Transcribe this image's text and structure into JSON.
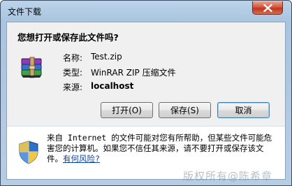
{
  "window": {
    "title": "文件下载",
    "question": "您想打开或保存此文件吗?"
  },
  "file": {
    "name_label": "名称:",
    "name": "Test.zip",
    "type_label": "类型:",
    "type": "WinRAR ZIP 压缩文件",
    "from_label": "来源:",
    "from": "localhost"
  },
  "buttons": {
    "open": "打开(O)",
    "save": "保存(S)",
    "cancel": "取消"
  },
  "warning": {
    "text": "来自 Internet 的文件可能对您有所帮助，但某些文件可能危害您的计算机。如果您不信任其来源，请不要打开或保存该文件。",
    "link": "有何风险?"
  },
  "watermark": "版权所有@陈希章",
  "icons": [
    "close-icon",
    "winrar-archive-icon",
    "security-shield-icon"
  ]
}
